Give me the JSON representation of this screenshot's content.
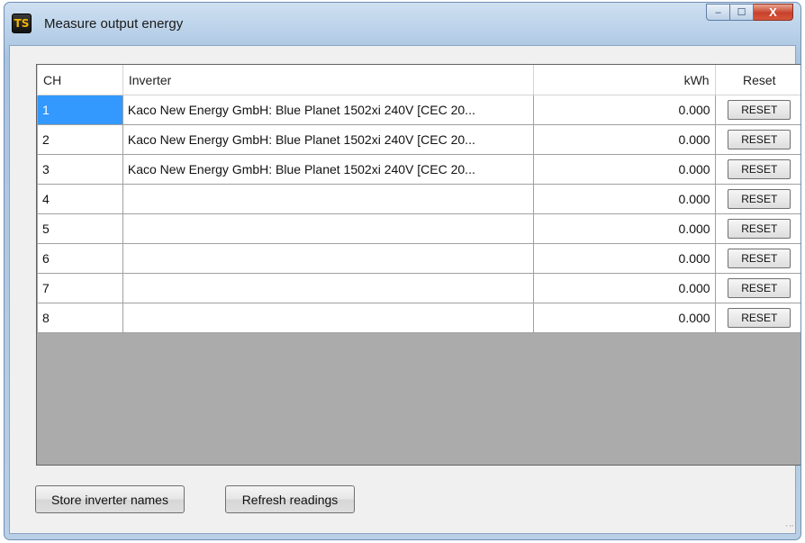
{
  "window": {
    "icon_text": "TS",
    "title": "Measure output energy",
    "minimize_glyph": "‒",
    "maximize_glyph": "☐",
    "close_glyph": "X"
  },
  "grid": {
    "headers": {
      "ch": "CH",
      "inverter": "Inverter",
      "kwh": "kWh",
      "reset": "Reset"
    },
    "rows": [
      {
        "ch": "1",
        "inverter": "Kaco New Energy GmbH: Blue Planet 1502xi 240V [CEC 20...",
        "kwh": "0.000",
        "reset": "RESET"
      },
      {
        "ch": "2",
        "inverter": "Kaco New Energy GmbH: Blue Planet 1502xi 240V [CEC 20...",
        "kwh": "0.000",
        "reset": "RESET"
      },
      {
        "ch": "3",
        "inverter": "Kaco New Energy GmbH: Blue Planet 1502xi 240V [CEC 20...",
        "kwh": "0.000",
        "reset": "RESET"
      },
      {
        "ch": "4",
        "inverter": "",
        "kwh": "0.000",
        "reset": "RESET"
      },
      {
        "ch": "5",
        "inverter": "",
        "kwh": "0.000",
        "reset": "RESET"
      },
      {
        "ch": "6",
        "inverter": "",
        "kwh": "0.000",
        "reset": "RESET"
      },
      {
        "ch": "7",
        "inverter": "",
        "kwh": "0.000",
        "reset": "RESET"
      },
      {
        "ch": "8",
        "inverter": "",
        "kwh": "0.000",
        "reset": "RESET"
      }
    ]
  },
  "buttons": {
    "store_label": "Store inverter names",
    "refresh_label": "Refresh readings"
  },
  "colors": {
    "selection": "#3399ff",
    "close_button": "#c7412b"
  }
}
